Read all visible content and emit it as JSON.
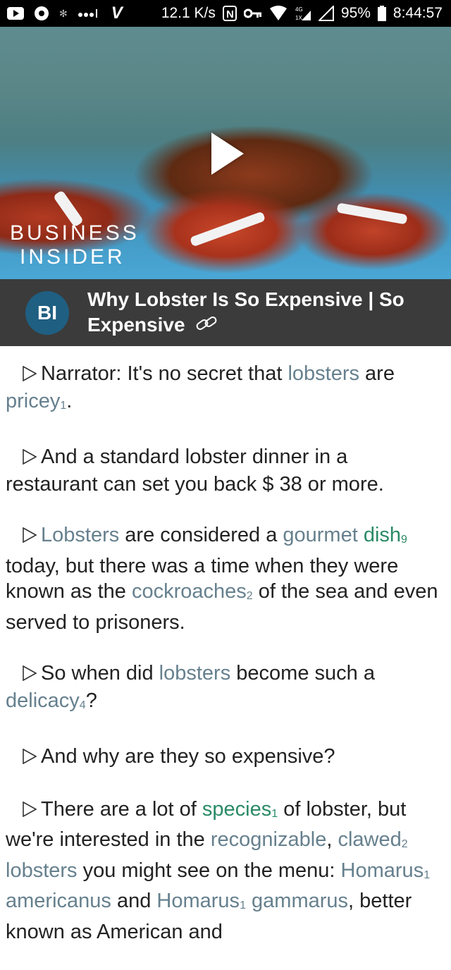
{
  "status_bar": {
    "speed": "12.1 K/s",
    "battery": "95%",
    "time": "8:44:57",
    "icons": [
      "youtube-icon",
      "chrome-icon",
      "bluetooth-icon",
      "signal-dots-icon",
      "v-icon",
      "nfc-icon",
      "key-icon",
      "wifi-icon",
      "4g-icon",
      "signal-icon",
      "battery-icon"
    ]
  },
  "video": {
    "brand_line1": "BUSINESS",
    "brand_line2": "INSIDER",
    "play_icon": "play-icon"
  },
  "header": {
    "avatar_text": "BI",
    "title": "Why Lobster Is So Expensive | So Expensive",
    "link_icon": "link-icon",
    "colors": {
      "bar": "#3b3b3b",
      "avatar": "#1f5f82"
    }
  },
  "transcript": {
    "colors": {
      "keyword": "#66808e",
      "keyword_green": "#2a8a67"
    },
    "p1": {
      "a": "Narrator: It's no secret that ",
      "k1": "lobsters",
      "b": " are ",
      "k2": "pricey",
      "s2": "1",
      "c": "."
    },
    "p2": {
      "a": "And a standard lobster dinner in a restaurant can set you back $ 38 or more."
    },
    "p3": {
      "k1": "Lobsters",
      "a": " are considered a ",
      "k2": "gourmet",
      "b": " ",
      "k3": "dish",
      "s3": "9",
      "c": " today, but there was a time when they were known as the ",
      "k4": "cockroaches",
      "s4": "2",
      "d": " of the sea and even served to prisoners."
    },
    "p4": {
      "a": "So when did ",
      "k1": "lobsters",
      "b": " become such a ",
      "k2": "delicacy",
      "s2": "4",
      "c": "?"
    },
    "p5": {
      "a": "And why are they so expensive?"
    },
    "p6": {
      "a": "There are a lot of ",
      "k1": "species",
      "s1": "1",
      "b": " of lobster, but we're interested in the ",
      "k2": "recognizable",
      "c": ", ",
      "k3": "clawed",
      "s3": "2",
      "d": " ",
      "k4": "lobsters",
      "e": " you might see on the menu: ",
      "k5": "Homarus",
      "s5": "1",
      "f": " ",
      "k6": "americanus",
      "g": " and ",
      "k7": "Homarus",
      "s7": "1",
      "h": " ",
      "k8": "gammarus",
      "i": ", better known as American and"
    }
  }
}
